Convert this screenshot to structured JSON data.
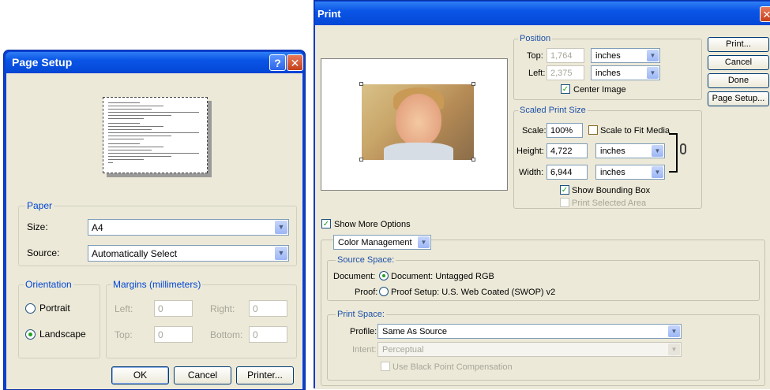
{
  "page_setup": {
    "title": "Page Setup",
    "help_label": "?",
    "close_label": "✕",
    "paper": {
      "legend": "Paper",
      "size_label": "Size:",
      "size_value": "A4",
      "source_label": "Source:",
      "source_value": "Automatically Select"
    },
    "orientation": {
      "legend": "Orientation",
      "portrait": "Portrait",
      "landscape": "Landscape",
      "selected": "Landscape"
    },
    "margins": {
      "legend": "Margins (millimeters)",
      "left_label": "Left:",
      "left_value": "0",
      "right_label": "Right:",
      "right_value": "0",
      "top_label": "Top:",
      "top_value": "0",
      "bottom_label": "Bottom:",
      "bottom_value": "0"
    },
    "buttons": {
      "ok": "OK",
      "cancel": "Cancel",
      "printer": "Printer..."
    }
  },
  "print": {
    "title": "Print",
    "close_label": "✕",
    "position": {
      "legend": "Position",
      "top_label": "Top:",
      "top_value": "1,764",
      "top_unit": "inches",
      "left_label": "Left:",
      "left_value": "2,375",
      "left_unit": "inches",
      "center_image": "Center Image",
      "center_checked": true
    },
    "scaled": {
      "legend": "Scaled Print Size",
      "scale_label": "Scale:",
      "scale_value": "100%",
      "scale_to_fit": "Scale to Fit Media",
      "height_label": "Height:",
      "height_value": "4,722",
      "height_unit": "inches",
      "width_label": "Width:",
      "width_value": "6,944",
      "width_unit": "inches",
      "show_bounding_box": "Show Bounding Box",
      "print_selected_area": "Print Selected Area"
    },
    "buttons": {
      "print": "Print...",
      "cancel": "Cancel",
      "done": "Done",
      "page_setup": "Page Setup..."
    },
    "show_more_options": "Show More Options",
    "mode_value": "Color Management",
    "source_space": {
      "legend": "Source Space:",
      "document_label": "Document:",
      "document_value": "Document: Untagged RGB",
      "proof_label": "Proof:",
      "proof_value": "Proof Setup: U.S. Web Coated (SWOP) v2"
    },
    "print_space": {
      "legend": "Print Space:",
      "profile_label": "Profile:",
      "profile_value": "Same As Source",
      "intent_label": "Intent:",
      "intent_value": "Perceptual",
      "black_point": "Use Black Point Compensation"
    }
  }
}
